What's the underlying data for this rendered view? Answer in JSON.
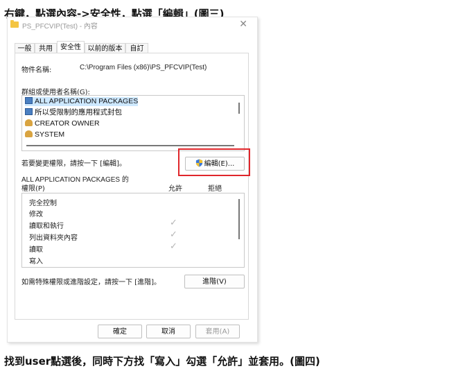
{
  "captions": {
    "top": "右鍵，點選內容->安全性，點選「編輯」(圖三)",
    "bottom": "找到user點選後，同時下方找「寫入」勾選「允許」並套用。(圖四)"
  },
  "window": {
    "title": "PS_PFCVIP(Test) - 內容",
    "close_glyph": "✕"
  },
  "tabs": [
    {
      "label": "一般",
      "active": false
    },
    {
      "label": "共用",
      "active": false
    },
    {
      "label": "安全性",
      "active": true
    },
    {
      "label": "以前的版本",
      "active": false
    },
    {
      "label": "自訂",
      "active": false
    }
  ],
  "object": {
    "label": "物件名稱:",
    "value": "C:\\Program Files (x86)\\PS_PFCVIP(Test)"
  },
  "groups": {
    "label": "群組或使用者名稱(G):",
    "items": [
      {
        "label": "ALL APPLICATION PACKAGES",
        "icon": "package-icon",
        "selected": true
      },
      {
        "label": "所以受限制的應用程式封包",
        "icon": "package-icon",
        "selected": false
      },
      {
        "label": "CREATOR OWNER",
        "icon": "users-icon",
        "selected": false
      },
      {
        "label": "SYSTEM",
        "icon": "users-icon",
        "selected": false
      }
    ]
  },
  "edit": {
    "hint": "若要變更權限，請按一下 [編輯]。",
    "button_label": "編輯(E)...",
    "button_icon": "uac-shield-icon"
  },
  "permissions": {
    "header_line1": "ALL APPLICATION PACKAGES 的",
    "header_line2": "權限(P)",
    "allow_label": "允許",
    "deny_label": "拒絕",
    "rows": [
      {
        "label": "完全控制",
        "allow": false
      },
      {
        "label": "修改",
        "allow": false
      },
      {
        "label": "讀取和執行",
        "allow": true
      },
      {
        "label": "列出資料夾內容",
        "allow": true
      },
      {
        "label": "讀取",
        "allow": true
      },
      {
        "label": "寫入",
        "allow": false
      }
    ]
  },
  "advanced": {
    "hint": "如需特殊權限或進階設定，請按一下 [進階]。",
    "button_label": "進階(V)"
  },
  "footer": {
    "ok_label": "確定",
    "cancel_label": "取消",
    "apply_label": "套用(A)"
  },
  "colors": {
    "highlight": "#e0262b",
    "selection": "#cde8ff"
  }
}
